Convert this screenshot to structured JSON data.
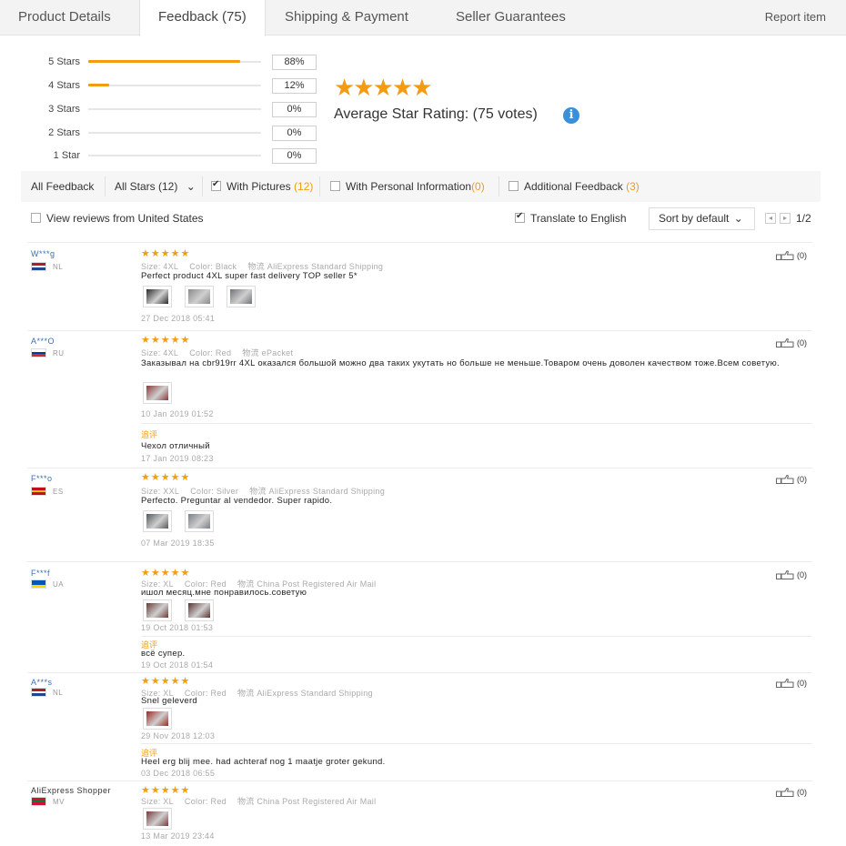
{
  "tabs": [
    {
      "label": "Product Details"
    },
    {
      "label": "Feedback (75)"
    },
    {
      "label": "Shipping & Payment"
    },
    {
      "label": "Seller Guarantees"
    }
  ],
  "report_label": "Report item",
  "histogram": [
    {
      "label": "5 Stars",
      "percent_text": "88%",
      "fraction": 0.88
    },
    {
      "label": "4 Stars",
      "percent_text": "12%",
      "fraction": 0.12
    },
    {
      "label": "3 Stars",
      "percent_text": "0%",
      "fraction": 0
    },
    {
      "label": "2 Stars",
      "percent_text": "0%",
      "fraction": 0
    },
    {
      "label": "1 Star",
      "percent_text": "0%",
      "fraction": 0
    }
  ],
  "summary": {
    "stars": "★★★★★",
    "text": "Average Star Rating:  (75 votes)",
    "info": "i"
  },
  "filters": {
    "all_feedback": "All Feedback",
    "all_stars": "All Stars (12)",
    "dropdown_icon": "⌄",
    "with_pictures": "With Pictures",
    "with_pictures_count": "(12)",
    "with_personal": "With Personal Information",
    "with_personal_count": "(0)",
    "additional": "Additional Feedback",
    "additional_count": "(3)"
  },
  "options": {
    "view_us": "View reviews from United States",
    "translate": "Translate to English",
    "sort": "Sort by default",
    "sort_icon": "⌄",
    "prev": "◂",
    "next": "▸",
    "page": "1/2"
  },
  "reviews": [
    {
      "user": "W***g",
      "country": "NL",
      "flag_colors": [
        "#ae1c28",
        "#ffffff",
        "#21468b"
      ],
      "stars": "★★★★★",
      "size": "Size: 4XL",
      "color": "Color: Black",
      "shipping": "物流 AliExpress Standard Shipping",
      "text": "Perfect product 4XL super fast delivery TOP seller 5*",
      "date": "27 Dec 2018 05:41",
      "helpful": "(0)",
      "photo_colors": [
        "#2a2a2a",
        "#8a8a8a",
        "#6f7378"
      ]
    },
    {
      "user": "A***O",
      "country": "RU",
      "flag_colors": [
        "#ffffff",
        "#0039a6",
        "#d52b1e"
      ],
      "stars": "★★★★★",
      "size": "Size: 4XL",
      "color": "Color: Red",
      "shipping": "物流 ePacket",
      "text": "Заказывал на cbr919rr 4XL оказался большой можно два таких укутать но больше не меньше.Товаром очень доволен качеством тоже.Всем советую.",
      "date": "10 Jan 2019 01:52",
      "additional_label": "追评",
      "additional_text": "Чехол отличный",
      "additional_date": "17 Jan 2019 08:23",
      "helpful": "(0)",
      "photo_colors": [
        "#8b3a3a"
      ]
    },
    {
      "user": "F***o",
      "country": "ES",
      "flag_colors": [
        "#c60b1e",
        "#ffc400",
        "#c60b1e"
      ],
      "stars": "★★★★★",
      "size": "Size: XXL",
      "color": "Color: Silver",
      "shipping": "物流 AliExpress Standard Shipping",
      "text": "Perfecto. Preguntar al vendedor. Super rapido.",
      "date": "07 Mar 2019 18:35",
      "helpful": "(0)",
      "photo_colors": [
        "#555a5e",
        "#7a8085"
      ]
    },
    {
      "user": "F***f",
      "country": "UA",
      "flag_colors": [
        "#0057b7",
        "#0057b7",
        "#ffd700"
      ],
      "stars": "★★★★★",
      "size": "Size: XL",
      "color": "Color: Red",
      "shipping": "物流 China Post Registered Air Mail",
      "text": "ишол месяц.мне понравилось.советую",
      "date": "19 Oct 2018 01:53",
      "additional_label": "追评",
      "additional_text": "всё супер.",
      "additional_date": "19 Oct 2018 01:54",
      "helpful": "(0)",
      "photo_colors": [
        "#6b3a36",
        "#5a3330"
      ]
    },
    {
      "user": "A***s",
      "country": "NL",
      "flag_colors": [
        "#ae1c28",
        "#ffffff",
        "#21468b"
      ],
      "stars": "★★★★★",
      "size": "Size: XL",
      "color": "Color: Red",
      "shipping": "物流 AliExpress Standard Shipping",
      "text": "Snel geleverd",
      "date": "29 Nov 2018 12:03",
      "additional_label": "追评",
      "additional_text": "Heel erg blij mee. had achteraf nog 1 maatje groter gekund.",
      "additional_date": "03 Dec 2018 06:55",
      "helpful": "(0)",
      "photo_colors": [
        "#9a2a22"
      ]
    },
    {
      "user": "AliExpress Shopper",
      "country": "MV",
      "flag_colors": [
        "#d21034",
        "#007e3a",
        "#d21034"
      ],
      "stars": "★★★★★",
      "size": "Size: XL",
      "color": "Color: Red",
      "shipping": "物流 China Post Registered Air Mail",
      "date": "13 Mar 2019 23:44",
      "helpful": "(0)",
      "photo_colors": [
        "#7a3a3a"
      ]
    }
  ],
  "colors": {
    "accent": "#f39c12",
    "link": "#3b6fb6",
    "info": "#3b8fd9"
  }
}
